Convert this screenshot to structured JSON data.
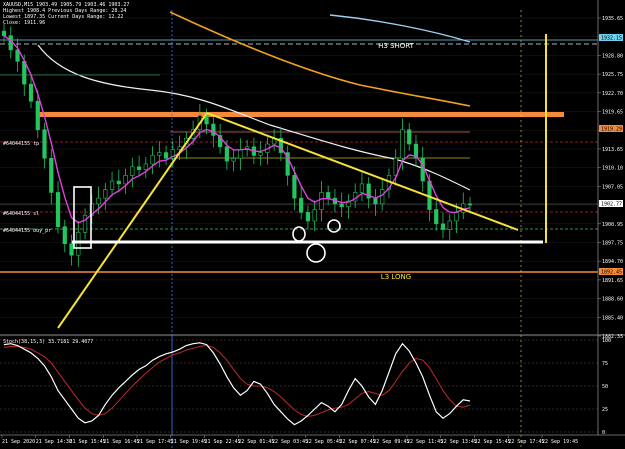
{
  "header": {
    "symbol_label": "XAUUSD,M15",
    "ohlc": "1903.49 1905.79 1903.46 1903.27"
  },
  "info_lines": [
    "Highest 1908.4     Previous Days Range: 28.24",
    "Lowest 1897.35     Current Days Range: 12.22",
    "Close: 1911.96"
  ],
  "levels": {
    "h3_short": "H3 SHORT",
    "l3_long": "L3 LONG",
    "tp_label": "#64044155 tp",
    "sl_label": "#64044155 sl",
    "buy_label": "#64044155 buy_pr",
    "h3_price": "1932.15",
    "orange_price": "1919.29",
    "l3_price": "1892.45",
    "last_price": "1902.77"
  },
  "colors": {
    "background": "#000000",
    "grid": "#3a3a3a",
    "candle": "#22c55e",
    "magenta_ma": "#e040e0",
    "white_ma": "#f0f0f0",
    "orange_ma": "#f2a020",
    "blue_ma": "#9ccff0",
    "yellow": "#f4e23a",
    "orange_zone": "#f48a3a",
    "stoch_main": "#ffffff",
    "stoch_signal": "#c0282a"
  },
  "stochastic": {
    "label": "Stoch(38,15,3) 33.7181 29.4077",
    "levels": [
      "100",
      "75",
      "50",
      "25",
      "0"
    ]
  },
  "chart_data": {
    "type": "line",
    "x": [
      "21 Sep 2020",
      "21 Sep 14:30",
      "21 Sep 15:45",
      "21 Sep 16:45",
      "21 Sep 17:45",
      "21 Sep 19:45",
      "21 Sep 22:45",
      "22 Sep 01:45",
      "22 Sep 03:45",
      "22 Sep 05:45",
      "22 Sep 07:45",
      "22 Sep 09:45",
      "22 Sep 11:45",
      "22 Sep 13:45",
      "22 Sep 15:45",
      "22 Sep 17:45",
      "22 Sep 19:45"
    ],
    "y_ticks": [
      "1935.65",
      "1932.15",
      "1928.80",
      "1925.75",
      "1922.70",
      "1919.65",
      "1916.60",
      "1913.65",
      "1910.10",
      "1907.05",
      "1904.00",
      "1900.95",
      "1897.75",
      "1894.70",
      "1891.65",
      "1888.60",
      "1885.40",
      "1882.35"
    ],
    "ylim": [
      1880.0,
      1937.0
    ],
    "close": [
      1932.5,
      1930.0,
      1928.0,
      1924.0,
      1921.0,
      1916.0,
      1911.0,
      1905.0,
      1899.0,
      1896.0,
      1894.0,
      1898.0,
      1901.0,
      1903.0,
      1904.0,
      1905.5,
      1907.0,
      1906.5,
      1908.0,
      1909.5,
      1909.0,
      1910.0,
      1911.5,
      1912.0,
      1911.0,
      1912.5,
      1913.0,
      1914.5,
      1916.0,
      1918.5,
      1917.0,
      1915.0,
      1913.0,
      1910.5,
      1911.0,
      1912.5,
      1913.0,
      1911.5,
      1912.0,
      1913.5,
      1914.5,
      1912.0,
      1908.0,
      1904.0,
      1901.5,
      1900.0,
      1902.0,
      1905.0,
      1904.0,
      1903.0,
      1902.5,
      1903.5,
      1905.0,
      1906.5,
      1904.0,
      1903.0,
      1905.5,
      1908.0,
      1911.0,
      1916.0,
      1913.5,
      1911.0,
      1907.0,
      1902.0,
      1899.5,
      1898.5,
      1900.0,
      1901.5,
      1903.0,
      1902.8
    ],
    "series": [],
    "stoch_main": [
      95,
      96,
      94,
      90,
      86,
      80,
      72,
      60,
      45,
      35,
      25,
      15,
      10,
      12,
      18,
      30,
      40,
      48,
      55,
      62,
      68,
      72,
      78,
      82,
      85,
      87,
      90,
      94,
      96,
      97,
      95,
      86,
      74,
      60,
      48,
      40,
      45,
      55,
      52,
      42,
      30,
      22,
      14,
      8,
      12,
      18,
      25,
      32,
      28,
      22,
      30,
      45,
      58,
      50,
      38,
      30,
      45,
      65,
      85,
      96,
      88,
      75,
      60,
      40,
      22,
      15,
      20,
      28,
      35,
      33.7
    ],
    "stoch_signal": [
      92,
      93,
      93,
      92,
      90,
      86,
      82,
      75,
      65,
      55,
      45,
      35,
      26,
      20,
      18,
      20,
      26,
      34,
      42,
      50,
      57,
      64,
      70,
      76,
      80,
      84,
      86,
      89,
      91,
      93,
      94,
      92,
      86,
      78,
      68,
      58,
      52,
      50,
      50,
      48,
      44,
      38,
      31,
      24,
      19,
      17,
      18,
      21,
      24,
      26,
      27,
      30,
      36,
      42,
      44,
      42,
      40,
      45,
      55,
      66,
      75,
      80,
      78,
      70,
      58,
      45,
      35,
      28,
      27,
      29.4
    ]
  }
}
